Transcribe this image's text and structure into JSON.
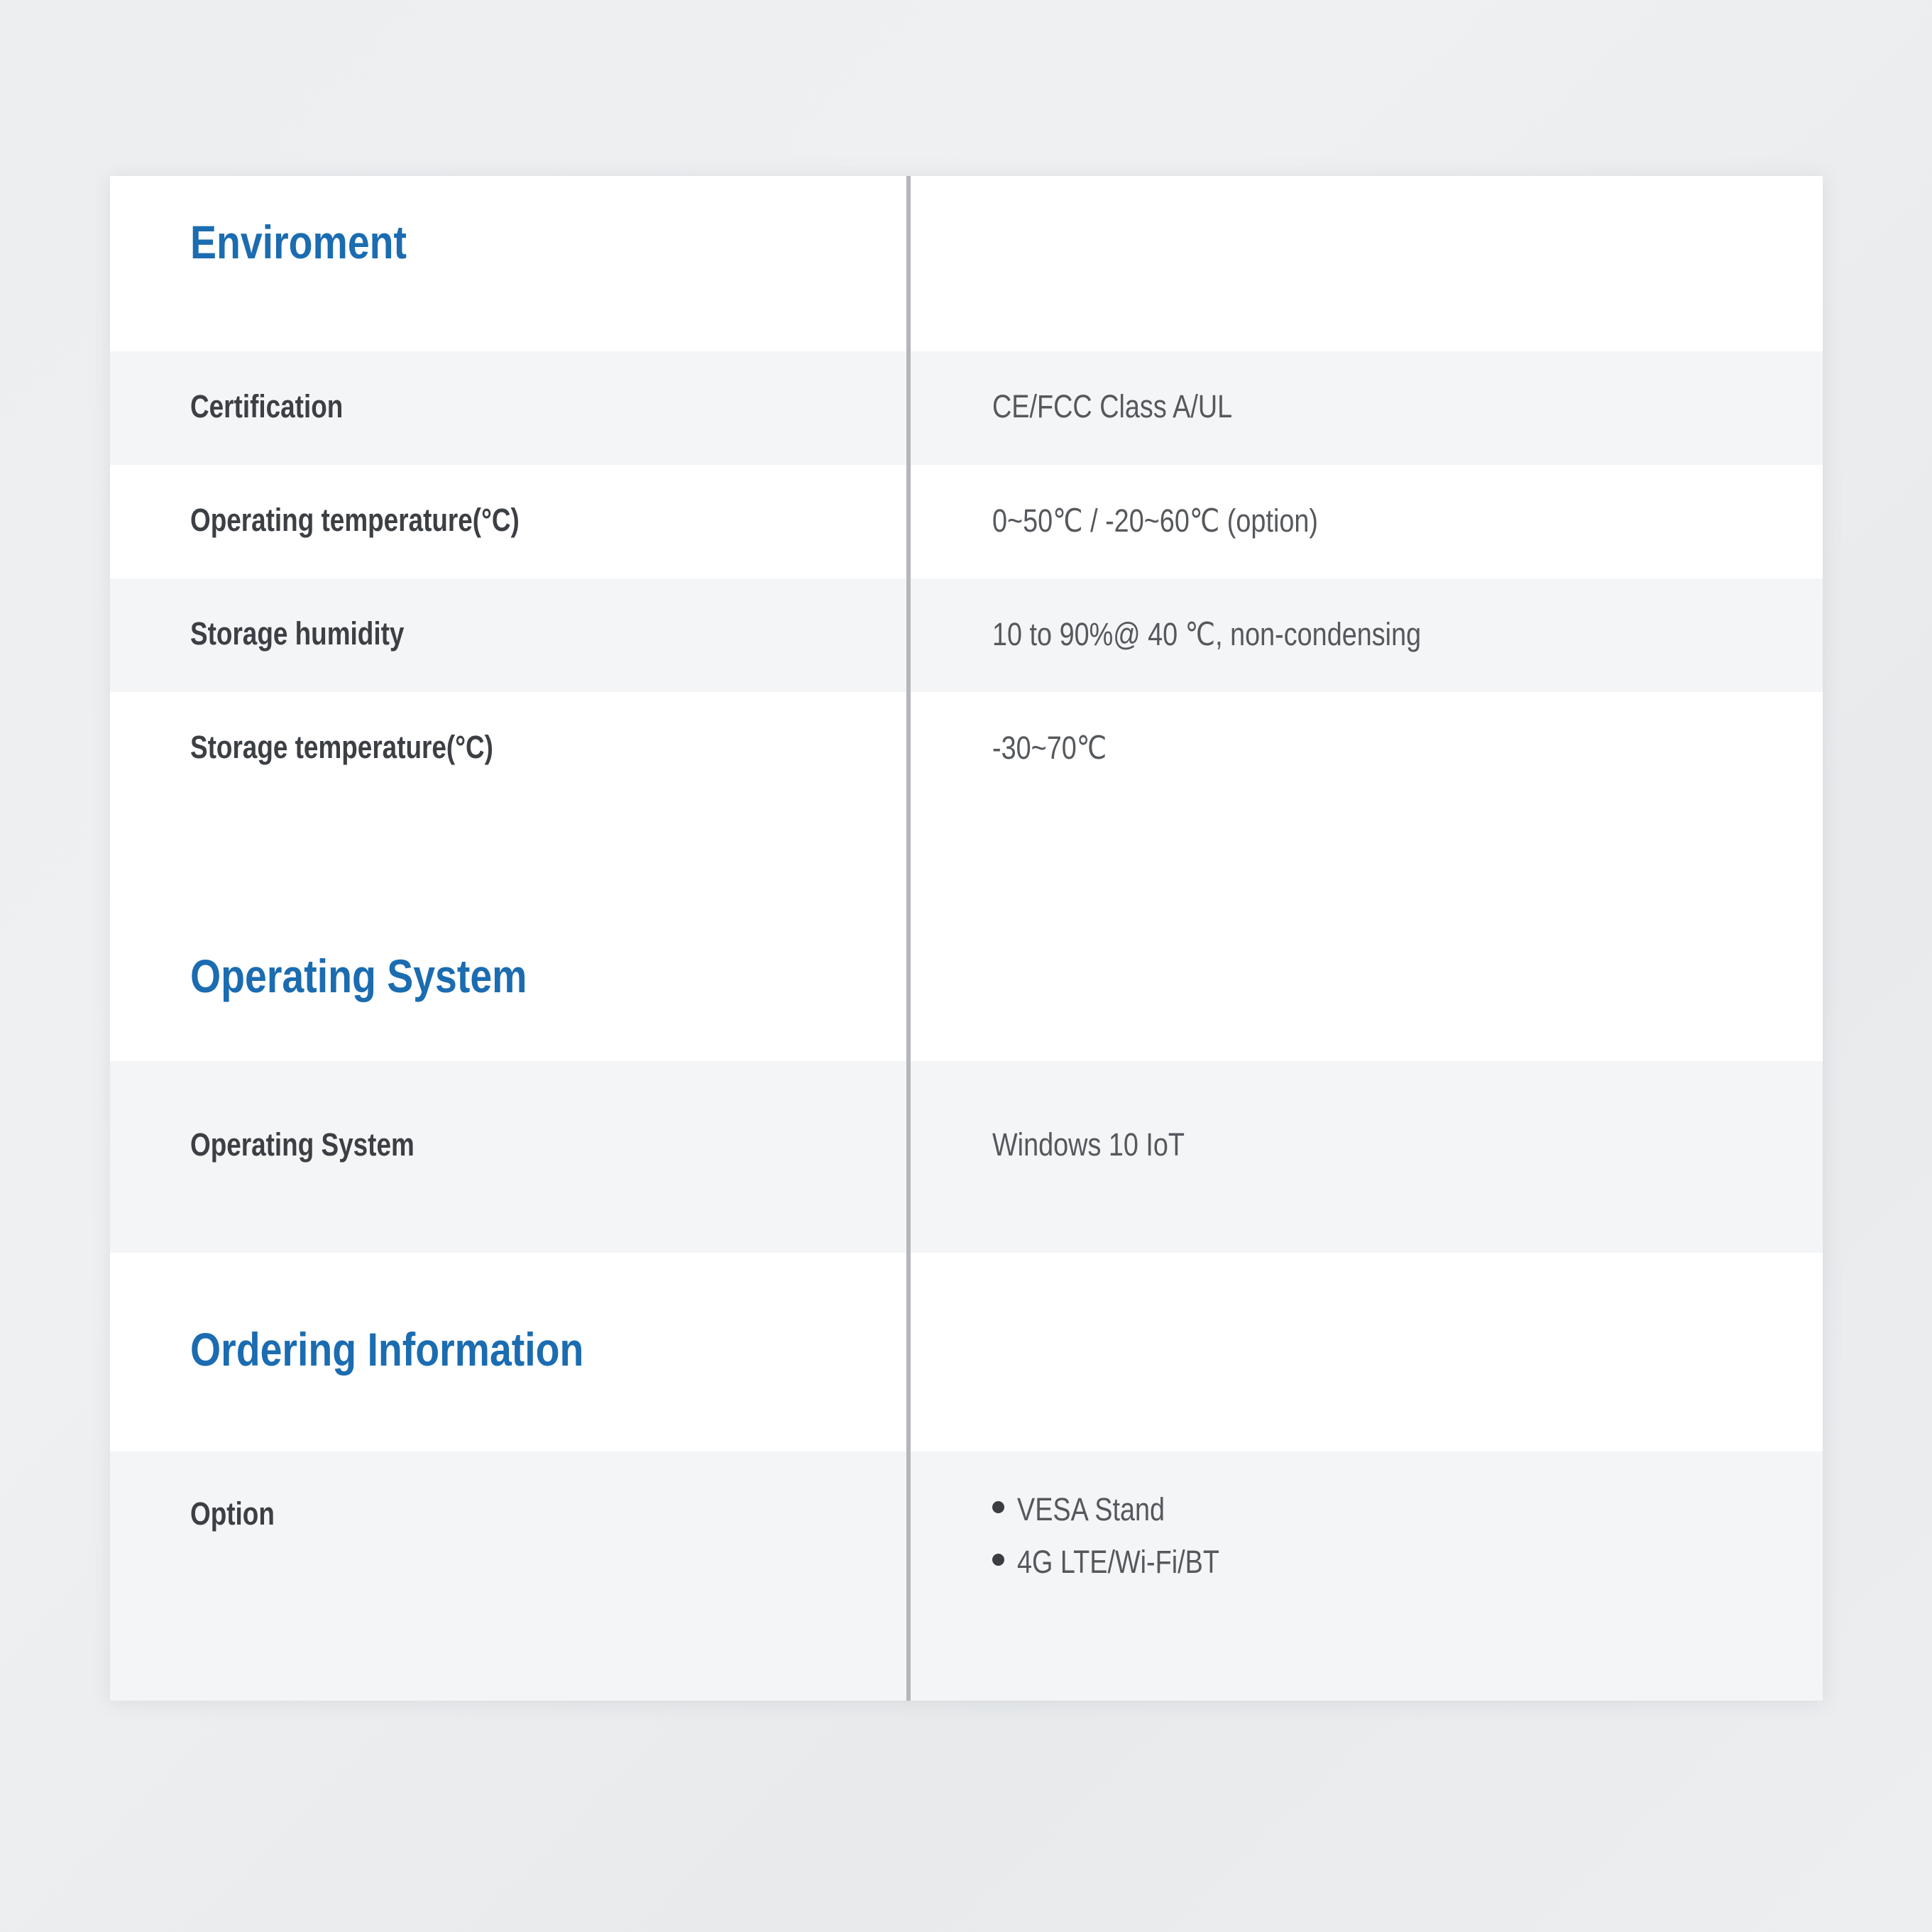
{
  "colors": {
    "heading_blue": "#1b6cb0",
    "label_text": "#3c3f43",
    "value_text": "#55585c",
    "row_shaded": "#f4f5f7",
    "row_plain": "#ffffff",
    "divider": "#b4b6ba",
    "page_background": "#eceef0"
  },
  "sections": [
    {
      "heading": "Enviroment",
      "rows": [
        {
          "label": "Certification",
          "value": "CE/FCC Class A/UL"
        },
        {
          "label": "Operating temperature(°C)",
          "value": "0~50℃ / -20~60℃ (option)"
        },
        {
          "label": "Storage humidity",
          "value": "10 to 90%@ 40 ℃, non-condensing"
        },
        {
          "label": "Storage temperature(°C)",
          "value": "-30~70℃"
        }
      ]
    },
    {
      "heading": "Operating System",
      "rows": [
        {
          "label": "Operating System",
          "value": "Windows 10 IoT"
        }
      ]
    },
    {
      "heading": "Ordering Information",
      "rows": [
        {
          "label": "Option",
          "bullets": [
            "VESA Stand",
            "4G LTE/Wi-Fi/BT"
          ]
        }
      ]
    }
  ]
}
